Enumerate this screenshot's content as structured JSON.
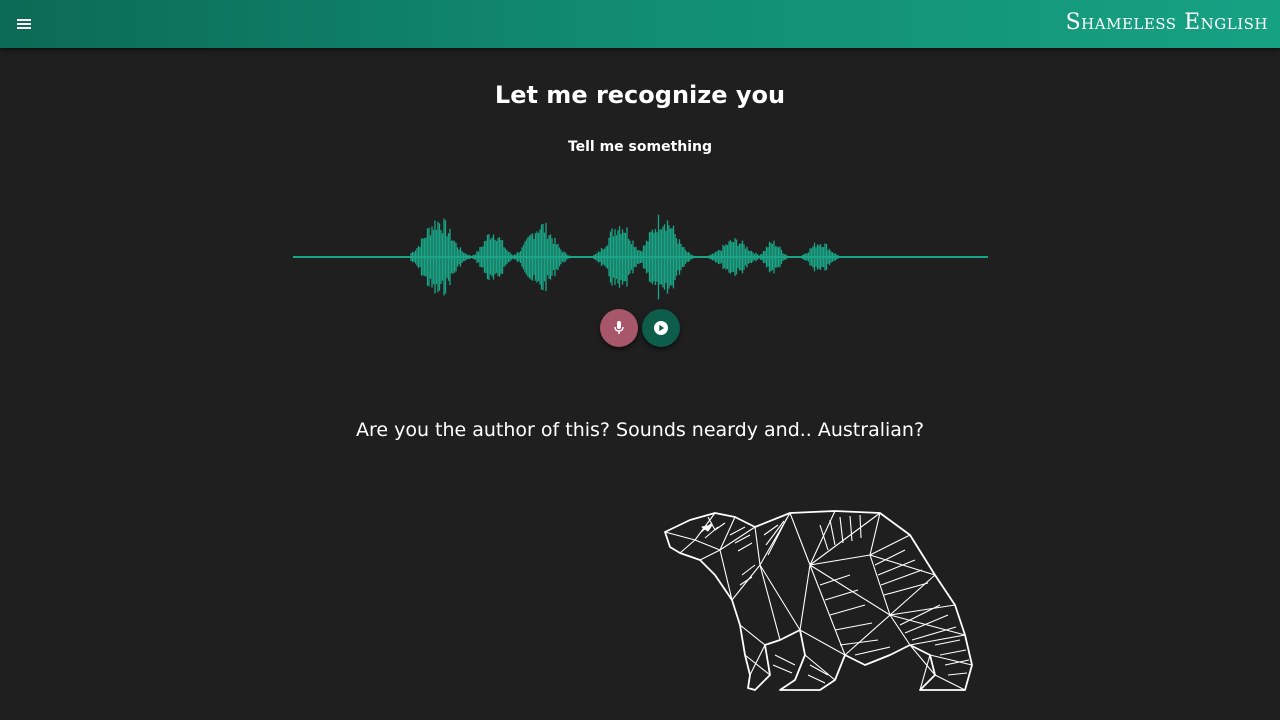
{
  "header": {
    "brand": "Shameless English",
    "menu_icon": "menu-icon"
  },
  "main": {
    "title": "Let me recognize you",
    "subtitle": "Tell me something",
    "waveform": {
      "color": "#1aa587"
    },
    "controls": {
      "mic": {
        "icon": "microphone-icon",
        "color": "#a8566a"
      },
      "play": {
        "icon": "play-icon",
        "color": "#0e5c4a"
      }
    },
    "result_text": "Are you the author of this? Sounds neardy and.. Australian?"
  },
  "illustration": {
    "icon": "polar-bear-icon"
  },
  "colors": {
    "accent": "#118d73",
    "background": "#1f1f1f"
  }
}
